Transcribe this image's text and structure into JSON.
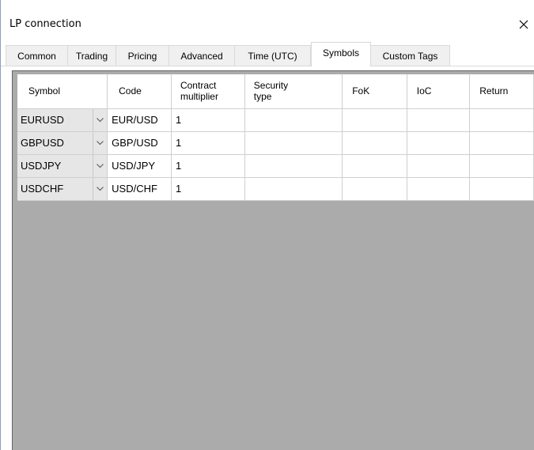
{
  "window": {
    "title": "LP connection"
  },
  "tabs": [
    {
      "label": "Common",
      "active": false
    },
    {
      "label": "Trading",
      "active": false
    },
    {
      "label": "Pricing",
      "active": false
    },
    {
      "label": "Advanced",
      "active": false
    },
    {
      "label": "Time (UTC)",
      "active": false
    },
    {
      "label": "Symbols",
      "active": true
    },
    {
      "label": "Custom Tags",
      "active": false
    }
  ],
  "grid": {
    "columns": [
      {
        "key": "symbol",
        "label": "Symbol"
      },
      {
        "key": "code",
        "label": "Code"
      },
      {
        "key": "contract_multiplier",
        "label": "Contract multiplier"
      },
      {
        "key": "security_type",
        "label": "Security type"
      },
      {
        "key": "fok",
        "label": "FoK"
      },
      {
        "key": "ioc",
        "label": "IoC"
      },
      {
        "key": "return",
        "label": "Return"
      }
    ],
    "rows": [
      {
        "symbol": "EURUSD",
        "code": "EUR/USD",
        "contract_multiplier": "1",
        "security_type": "",
        "fok": "",
        "ioc": "",
        "return": ""
      },
      {
        "symbol": "GBPUSD",
        "code": "GBP/USD",
        "contract_multiplier": "1",
        "security_type": "",
        "fok": "",
        "ioc": "",
        "return": ""
      },
      {
        "symbol": "USDJPY",
        "code": "USD/JPY",
        "contract_multiplier": "1",
        "security_type": "",
        "fok": "",
        "ioc": "",
        "return": ""
      },
      {
        "symbol": "USDCHF",
        "code": "USD/CHF",
        "contract_multiplier": "1",
        "security_type": "",
        "fok": "",
        "ioc": "",
        "return": ""
      }
    ]
  },
  "icons": {
    "close": "close-icon",
    "dropdown": "chevron-down-icon"
  },
  "colors": {
    "grid_background": "#ababab",
    "combo_background": "#e6e6e6",
    "tab_background": "#f0f0f0"
  }
}
